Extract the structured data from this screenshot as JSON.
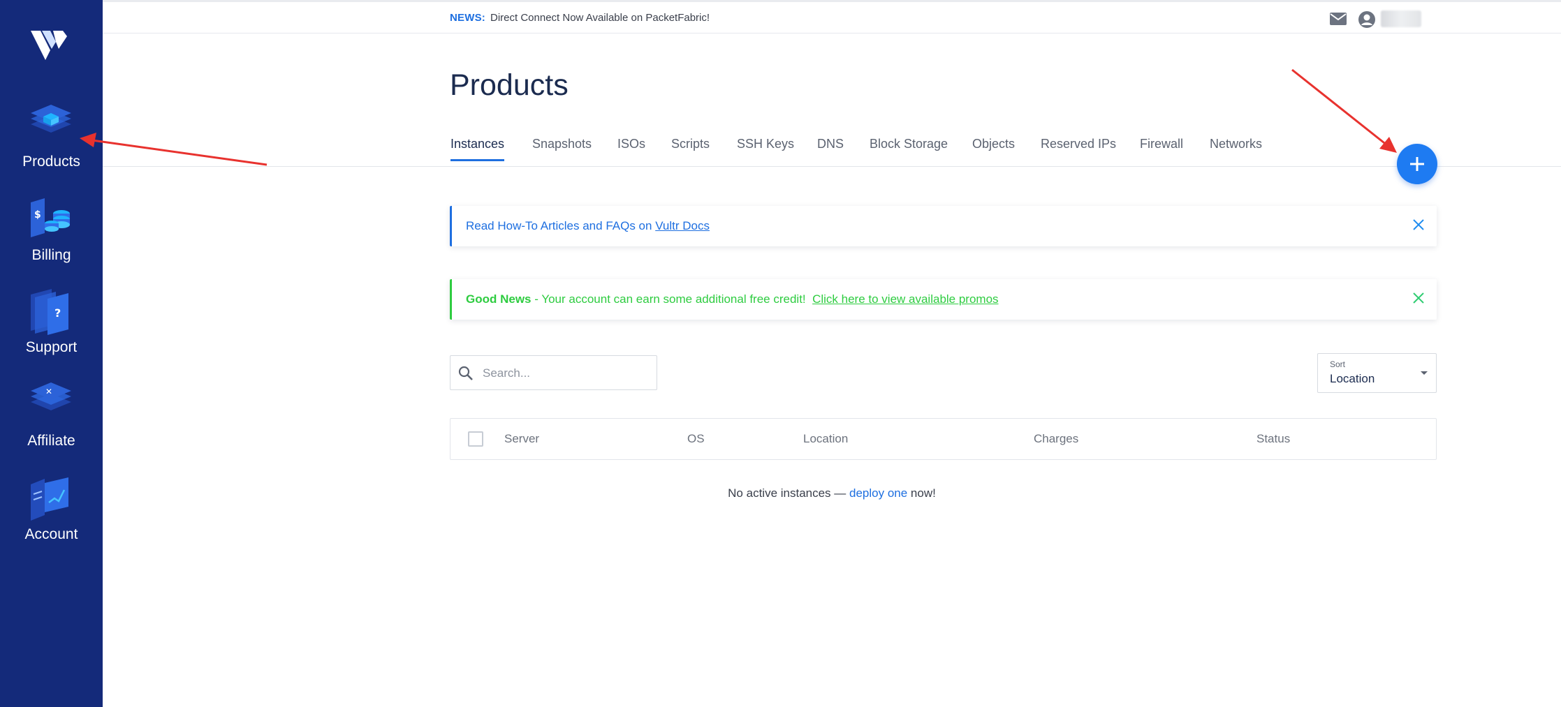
{
  "sidebar": {
    "items": [
      {
        "label": "Products"
      },
      {
        "label": "Billing"
      },
      {
        "label": "Support"
      },
      {
        "label": "Affiliate"
      },
      {
        "label": "Account"
      }
    ]
  },
  "topbar": {
    "news_tag": "NEWS:",
    "news_text": "Direct Connect Now Available on PacketFabric!"
  },
  "page": {
    "title": "Products"
  },
  "tabs": [
    {
      "label": "Instances",
      "active": true
    },
    {
      "label": "Snapshots"
    },
    {
      "label": "ISOs"
    },
    {
      "label": "Scripts"
    },
    {
      "label": "SSH Keys"
    },
    {
      "label": "DNS"
    },
    {
      "label": "Block Storage"
    },
    {
      "label": "Objects"
    },
    {
      "label": "Reserved IPs"
    },
    {
      "label": "Firewall"
    },
    {
      "label": "Networks"
    }
  ],
  "alerts": {
    "info": {
      "text": "Read How-To Articles and FAQs on ",
      "link": "Vultr Docs"
    },
    "success": {
      "strong": "Good News",
      "text": " - Your account can earn some additional free credit!  ",
      "link": "Click here to view available promos"
    }
  },
  "search": {
    "placeholder": "Search..."
  },
  "sort": {
    "label": "Sort",
    "value": "Location"
  },
  "table": {
    "columns": [
      "Server",
      "OS",
      "Location",
      "Charges",
      "Status"
    ]
  },
  "empty": {
    "prefix": "No active instances — ",
    "link": "deploy one",
    "suffix": " now!"
  },
  "colors": {
    "sidebar_bg": "#142a7a",
    "accent": "#1e6fe0",
    "success": "#2ecc40",
    "annotation_arrow": "#e8322e"
  }
}
